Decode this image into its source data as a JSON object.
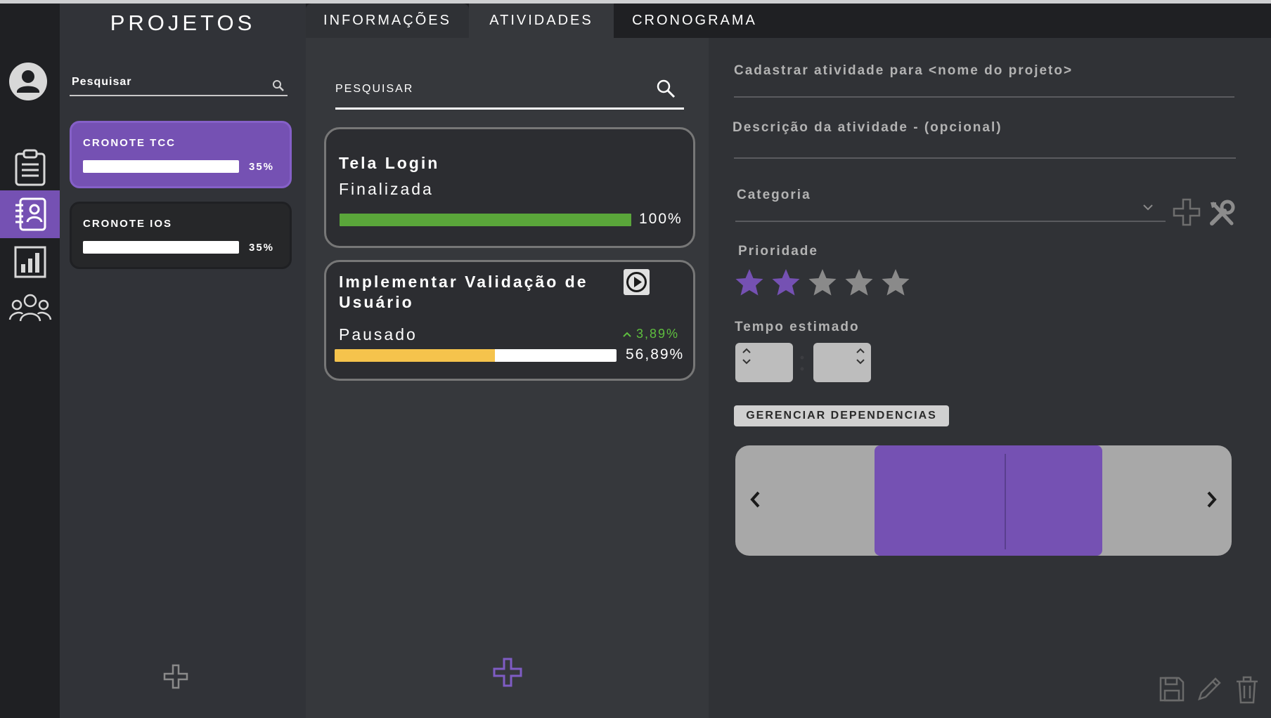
{
  "colors": {
    "accent": "#7551b3",
    "progress_done": "#5aa63a",
    "progress_paused": "#f5c34c",
    "trend_up": "#5fbf3f",
    "star_active": "#7551b3",
    "star_inactive": "#8a8a8a"
  },
  "sidebar": {
    "icons": [
      "user-avatar-icon",
      "clipboard-icon",
      "notebook-icon",
      "bar-chart-icon",
      "team-icon"
    ],
    "active_index": 2
  },
  "projects": {
    "title": "PROJETOS",
    "search_label": "Pesquisar",
    "items": [
      {
        "name": "CRONOTE TCC",
        "progress_label": "35%",
        "progress": 35,
        "selected": true
      },
      {
        "name": "CRONOTE IOS",
        "progress_label": "35%",
        "progress": 35,
        "selected": false
      }
    ]
  },
  "tabs": [
    {
      "label": "INFORMAÇÕES"
    },
    {
      "label": "ATIVIDADES"
    },
    {
      "label": "CRONOGRAMA"
    }
  ],
  "activities": {
    "search_label": "PESQUISAR",
    "items": [
      {
        "title": "Tela Login",
        "status": "Finalizada",
        "progress": 100,
        "progress_label": "100%"
      },
      {
        "title_line1": "Implementar Validação de",
        "title_line2": "Usuário",
        "status": "Pausado",
        "progress": 56.89,
        "progress_label": "56,89%",
        "trend_label": "3,89%"
      }
    ]
  },
  "form": {
    "register_label": "Cadastrar atividade para  <nome do projeto>",
    "description_label": "Descrição da atividade - (opcional)",
    "category_label": "Categoria",
    "priority_label": "Prioridade",
    "priority_value": 2,
    "priority_max": 5,
    "time_label": "Tempo estimado",
    "dependencies_button": "GERENCIAR DEPENDENCIAS"
  }
}
